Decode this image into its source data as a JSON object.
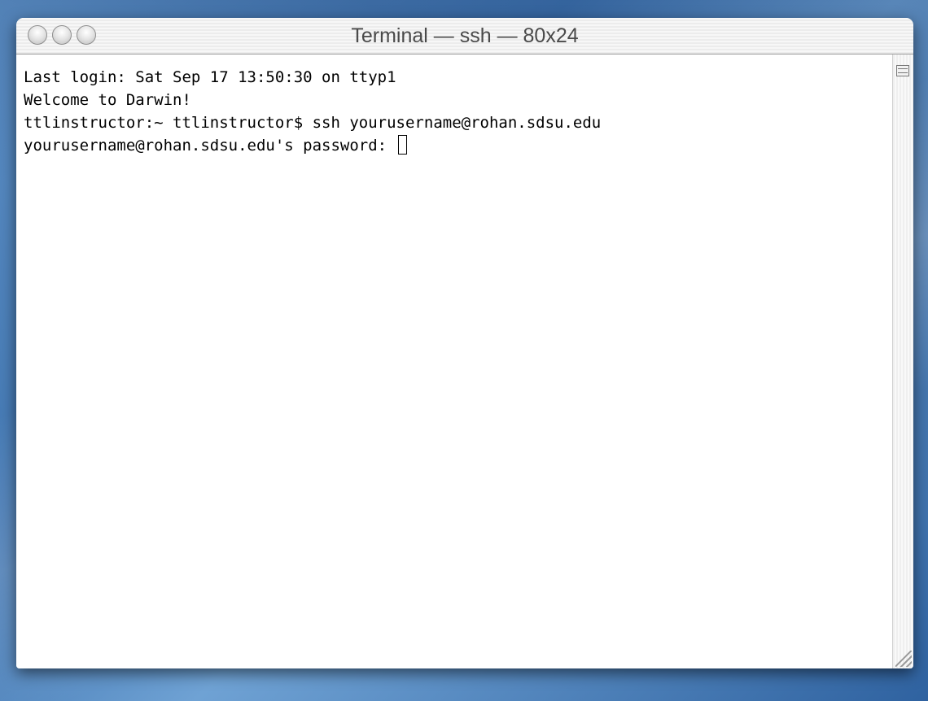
{
  "window": {
    "title": "Terminal — ssh — 80x24"
  },
  "terminal": {
    "lines": [
      "Last login: Sat Sep 17 13:50:30 on ttyp1",
      "Welcome to Darwin!",
      "ttlinstructor:~ ttlinstructor$ ssh yourusername@rohan.sdsu.edu",
      "yourusername@rohan.sdsu.edu's password: "
    ]
  },
  "icons": {
    "close": "close-traffic-light-icon",
    "minimize": "minimize-traffic-light-icon",
    "zoom": "zoom-traffic-light-icon",
    "split": "split-pane-icon",
    "resize": "resize-grip-icon"
  },
  "colors": {
    "desktop": "#3f74b0",
    "terminal_bg": "#ffffff",
    "terminal_fg": "#000000"
  }
}
